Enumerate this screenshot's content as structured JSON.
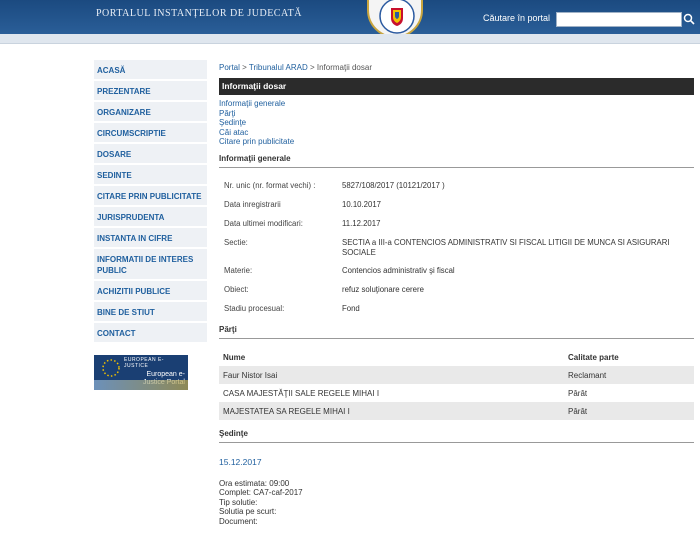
{
  "header": {
    "portal_title": "PORTALUL INSTANȚELOR DE JUDECATĂ",
    "search_label": "Căutare în portal",
    "search_value": "",
    "accent": "#1f4f86"
  },
  "sidebar": {
    "items": [
      {
        "label": "ACASĂ"
      },
      {
        "label": "PREZENTARE"
      },
      {
        "label": "ORGANIZARE"
      },
      {
        "label": "CIRCUMSCRIPTIE"
      },
      {
        "label": "DOSARE"
      },
      {
        "label": "SEDINTE"
      },
      {
        "label": "CITARE PRIN PUBLICITATE"
      },
      {
        "label": "JURISPRUDENTA"
      },
      {
        "label": "INSTANTA IN CIFRE"
      },
      {
        "label": "INFORMATII DE INTERES PUBLIC"
      },
      {
        "label": "ACHIZITII PUBLICE"
      },
      {
        "label": "BINE DE STIUT"
      },
      {
        "label": "CONTACT"
      }
    ],
    "ejustice": {
      "top": "EUROPEAN E-JUSTICE",
      "name": "European e-Justice Portal"
    }
  },
  "breadcrumb": {
    "portal": "Portal",
    "sep1": " > ",
    "court": "Tribunalul ARAD",
    "sep2": " > ",
    "current": "Informaţii dosar"
  },
  "main": {
    "title": "Informaţii dosar",
    "anchors": [
      "Informaţii generale",
      "Părţi",
      "Şedinţe",
      "Căi atac",
      "Citare prin publicitate"
    ],
    "info_heading": "Informaţii generale",
    "info": [
      {
        "k": "Nr. unic (nr. format vechi) :",
        "v": "5827/108/2017 (10121/2017 )"
      },
      {
        "k": "Data inregistrarii",
        "v": "10.10.2017"
      },
      {
        "k": "Data ultimei modificari:",
        "v": "11.12.2017"
      },
      {
        "k": "Sectie:",
        "v": "SECTIA a III-a CONTENCIOS ADMINISTRATIV SI FISCAL LITIGII DE MUNCA SI ASIGURARI SOCIALE"
      },
      {
        "k": "Materie:",
        "v": "Contencios administrativ şi fiscal"
      },
      {
        "k": "Obiect:",
        "v": "refuz soluţionare cerere"
      },
      {
        "k": "Stadiu procesual:",
        "v": "Fond"
      }
    ],
    "parti_heading": "Părţi",
    "parties_header": {
      "name": "Nume",
      "role": "Calitate parte"
    },
    "parties": [
      {
        "name": "Faur Nistor Isai",
        "role": "Reclamant"
      },
      {
        "name": "CASA MAJESTĂŢII SALE REGELE MIHAI I",
        "role": "Pârât"
      },
      {
        "name": "MAJESTATEA SA REGELE MIHAI I",
        "role": "Pârât"
      }
    ],
    "sedinte_heading": "Şedinţe",
    "hearing": {
      "date": "15.12.2017",
      "lines": [
        "Ora estimata: 09:00",
        "Complet: CA7-caf-2017",
        "Tip solutie:",
        "Solutia pe scurt:",
        "Document:"
      ]
    }
  }
}
